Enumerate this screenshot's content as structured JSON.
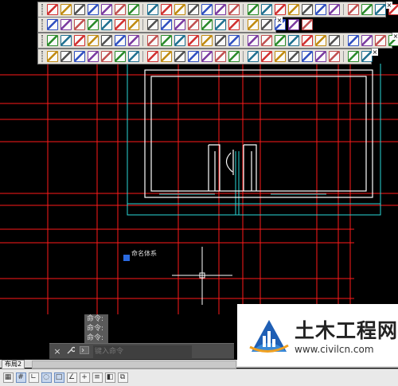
{
  "toolbars": [
    {
      "name": "toolbar-row-1",
      "close_label": "×",
      "buttons": 27
    },
    {
      "name": "toolbar-row-2",
      "close_label": "×",
      "buttons": 19
    },
    {
      "name": "toolbar-row-3",
      "close_label": "×",
      "buttons": 28
    },
    {
      "name": "toolbar-row-4",
      "close_label": "×",
      "buttons": 23
    }
  ],
  "command_history": [
    "命令:",
    "命令:",
    "命令:"
  ],
  "command_bar": {
    "close_icon": "×",
    "settings_icon": "wrench-icon",
    "prompt_icon": "command-prompt-icon",
    "placeholder": "键入命令"
  },
  "layout_tab": {
    "label": "布局2"
  },
  "status_icons": [
    "snap-icon",
    "grid-icon",
    "ortho-icon",
    "polar-icon",
    "osnap-icon",
    "otrack-icon",
    "lineweight-icon",
    "model-space-icon",
    "quick-properties-icon",
    "selection-cycling-icon"
  ],
  "drawing_annotation": "命名体系",
  "watermark": {
    "title": "土木工程网",
    "url": "www.civilcn.com"
  },
  "colors": {
    "background": "#000000",
    "grid_lines": "#ff1a1a",
    "wall_lines": "#ffffff",
    "dimension_lines": "#2ad8d8",
    "crosshair": "#ffffff",
    "grip": "#2a6ae0"
  }
}
